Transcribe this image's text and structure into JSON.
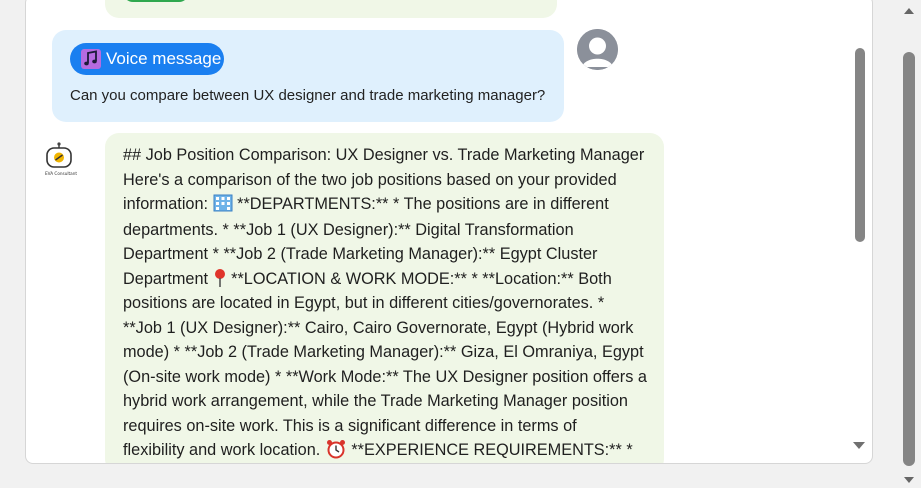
{
  "user_message": {
    "voice_label": "Voice message",
    "text": "Can you compare between UX designer and trade marketing manager?"
  },
  "bot": {
    "avatar_caption": "EVA Consultant",
    "line1": "## Job Position Comparison: UX Designer vs. Trade Marketing Manager",
    "line2": "Here's a comparison of the two job positions based on your provided",
    "line3a": "information: ",
    "line3b": " **DEPARTMENTS:** * The positions are in different",
    "line4": "departments. * **Job 1 (UX Designer):** Digital Transformation",
    "line5": "Department * **Job 2 (Trade Marketing Manager):** Egypt Cluster",
    "line6a": "Department ",
    "line6b": " **LOCATION & WORK MODE:** * **Location:** Both",
    "line7": "positions are located in Egypt, but in different cities/governorates. *",
    "line8": "**Job 1 (UX Designer):** Cairo, Cairo Governorate, Egypt (Hybrid work",
    "line9": "mode) * **Job 2 (Trade Marketing Manager):** Giza, El Omraniya, Egypt",
    "line10": "(On-site work mode) * **Work Mode:** The UX Designer position offers a",
    "line11": "hybrid work arrangement, while the Trade Marketing Manager position",
    "line12": "requires on-site work. This is a significant difference in terms of",
    "line13a": "flexibility and work location. ",
    "line13b": " **EXPERIENCE REQUIREMENTS:** *"
  },
  "icons": {
    "voice": "music-note-icon",
    "departments": "office-building-icon",
    "location": "pushpin-icon",
    "experience": "alarm-clock-icon"
  },
  "colors": {
    "user_bubble": "#dff0fd",
    "bot_bubble": "#f0f7e7",
    "voice_pill": "#1a7ff0"
  }
}
